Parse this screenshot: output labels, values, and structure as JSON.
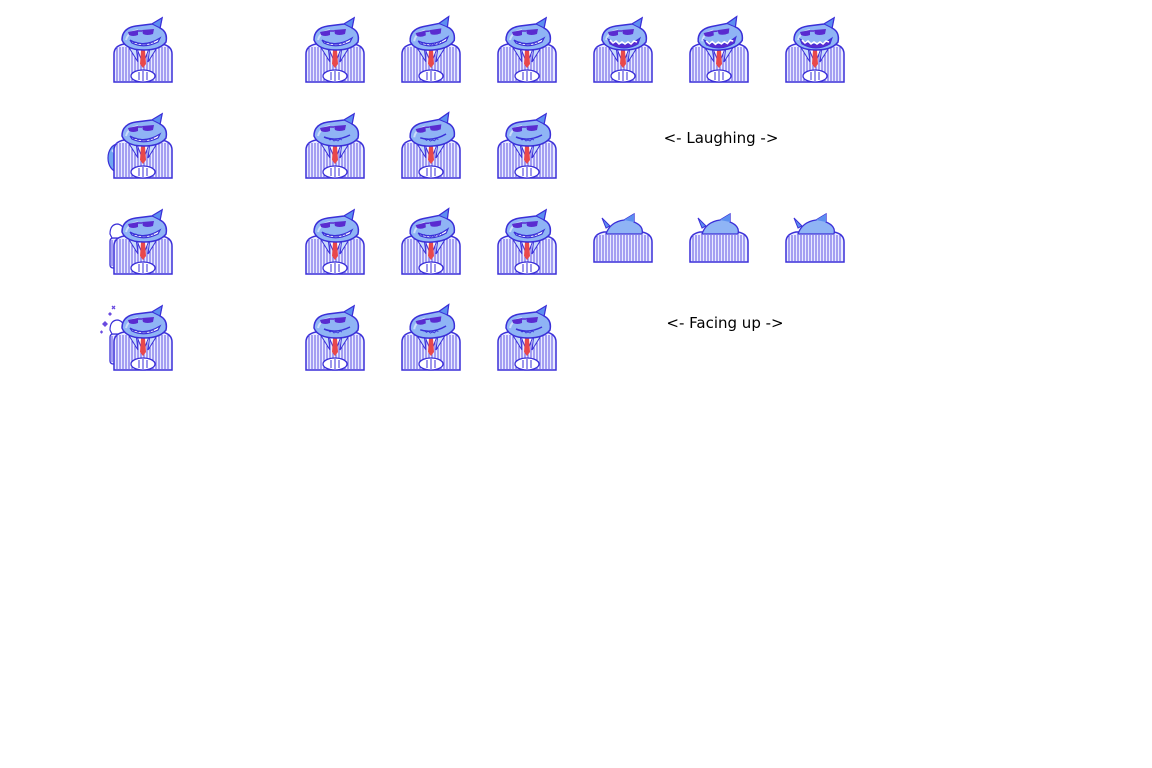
{
  "sprite_sheet": {
    "background": "#ffffff",
    "palette": {
      "outline": "#3a2fd8",
      "body": "#8fb4f5",
      "body_light": "#c9dcfb",
      "fin": "#5d8ff0",
      "shades": "#5a2bd0",
      "suit": "#e9ecff",
      "suit_stripe": "#5f52e6",
      "shirt": "#ffffff",
      "tie": "#e8484b",
      "teeth": "#ffffff",
      "hand": "#ffffff",
      "sparkle": "#6a4be0",
      "bubble": "#6fa6f0"
    },
    "labels": {
      "laughing": "<- Laughing ->",
      "facing_up": "<- Facing up ->"
    },
    "rows": [
      {
        "name": "row-1",
        "sprites": [
          {
            "name": "shark-portrait-idle-icon",
            "pose": "idle"
          },
          {
            "name": "shark-talk-frame-1-icon",
            "pose": "grin"
          },
          {
            "name": "shark-talk-frame-2-icon",
            "pose": "grin-wide"
          },
          {
            "name": "shark-talk-frame-3-icon",
            "pose": "grin"
          },
          {
            "name": "shark-laugh-frame-1-icon",
            "pose": "laugh"
          },
          {
            "name": "shark-laugh-frame-2-icon",
            "pose": "laugh-tilt"
          },
          {
            "name": "shark-laugh-frame-3-icon",
            "pose": "laugh"
          }
        ]
      },
      {
        "name": "row-2",
        "sprites": [
          {
            "name": "shark-portrait-blue-effect-icon",
            "pose": "effect"
          },
          {
            "name": "shark-smirk-frame-1-icon",
            "pose": "smirk"
          },
          {
            "name": "shark-smirk-frame-2-icon",
            "pose": "smirk-tilt"
          },
          {
            "name": "shark-smirk-frame-3-icon",
            "pose": "smirk"
          }
        ]
      },
      {
        "name": "row-3",
        "sprites": [
          {
            "name": "shark-portrait-raised-hand-icon",
            "pose": "raise"
          },
          {
            "name": "shark-grin-frame-1-icon",
            "pose": "grin"
          },
          {
            "name": "shark-grin-frame-2-icon",
            "pose": "grin-wide"
          },
          {
            "name": "shark-grin-frame-3-icon",
            "pose": "grin"
          },
          {
            "name": "shark-facing-up-frame-1-icon",
            "pose": "back"
          },
          {
            "name": "shark-facing-up-frame-2-icon",
            "pose": "back"
          },
          {
            "name": "shark-facing-up-frame-3-icon",
            "pose": "back"
          }
        ]
      },
      {
        "name": "row-4",
        "sprites": [
          {
            "name": "shark-portrait-sparkle-icon",
            "pose": "sparkle"
          },
          {
            "name": "shark-look-frame-1-icon",
            "pose": "smirk"
          },
          {
            "name": "shark-look-frame-2-icon",
            "pose": "smirk-tilt"
          },
          {
            "name": "shark-look-frame-3-icon",
            "pose": "smirk"
          }
        ]
      }
    ]
  }
}
